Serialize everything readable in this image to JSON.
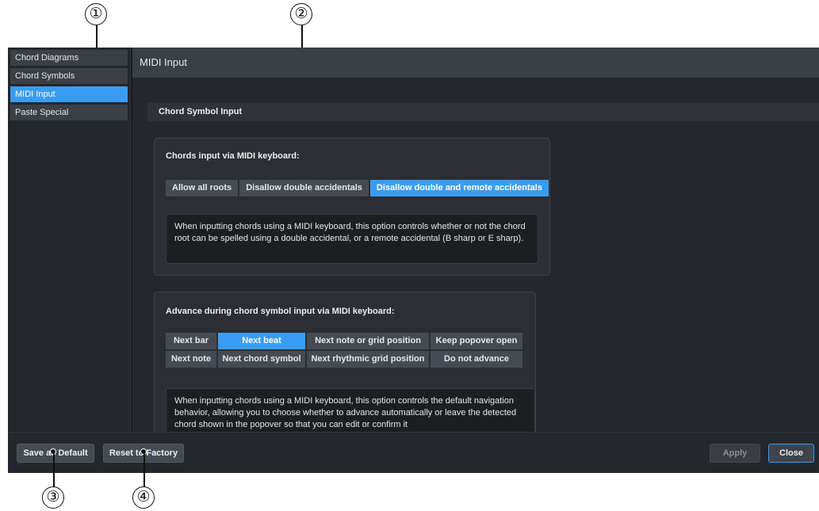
{
  "callouts": [
    "①",
    "②",
    "③",
    "④"
  ],
  "sidebar": {
    "items": [
      {
        "label": "Chord Diagrams"
      },
      {
        "label": "Chord Symbols"
      },
      {
        "label": "MIDI Input"
      },
      {
        "label": "Paste Special"
      }
    ],
    "active_index": 2
  },
  "content": {
    "header": "MIDI Input",
    "section": "Chord Symbol Input",
    "panel1": {
      "title": "Chords input via MIDI keyboard:",
      "options": [
        "Allow all roots",
        "Disallow double accidentals",
        "Disallow double and remote accidentals"
      ],
      "selected": "Disallow double and remote accidentals",
      "description": "When inputting chords using a MIDI keyboard, this option controls whether or not the chord root can be spelled using a double accidental, or a remote accidental (B sharp or E sharp)."
    },
    "panel2": {
      "title": "Advance during chord symbol input via MIDI keyboard:",
      "options": [
        "Next bar",
        "Next beat",
        "Next note or grid position",
        "Keep popover open",
        "Next note",
        "Next chord symbol",
        "Next rhythmic grid position",
        "Do not advance"
      ],
      "selected": "Next beat",
      "description": "When inputting chords using a MIDI keyboard, this option controls the default navigation behavior, allowing you to choose whether to advance automatically or leave the detected chord shown in the popover so that you can edit or confirm it"
    }
  },
  "footer": {
    "save_default": "Save as Default",
    "reset_factory": "Reset to Factory",
    "apply": "Apply",
    "close": "Close"
  },
  "colors": {
    "accent": "#3a9cf0",
    "background": "#24272c"
  }
}
